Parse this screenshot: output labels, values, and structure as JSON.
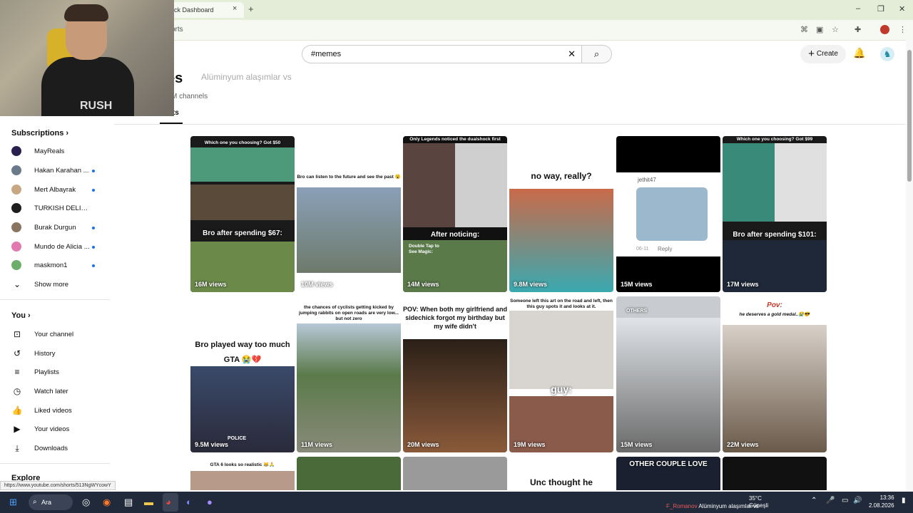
{
  "browser": {
    "tab_title": "ck Dashboard",
    "tab_close": "×",
    "new_tab": "+",
    "address_fragment": "orts",
    "window_controls": {
      "minimize": "–",
      "restore": "❐",
      "close": "✕"
    }
  },
  "webcam": {
    "shirt_text": "RUSH"
  },
  "header": {
    "search_value": "#memes",
    "create_label": "Create"
  },
  "page": {
    "title": "es",
    "title_overlay": "Alüminyum alaşımlar vs",
    "channels": "M channels",
    "active_tab": "rts"
  },
  "sidebar": {
    "subscriptions_heading": "Subscriptions",
    "subscriptions": [
      {
        "label": "MayReals",
        "live": false,
        "color": "#2a2050"
      },
      {
        "label": "Hakan Karahan ...",
        "live": true,
        "color": "#6b7a8a"
      },
      {
        "label": "Mert Albayrak",
        "live": true,
        "color": "#c8a884"
      },
      {
        "label": "TURKISH DELIGHT ...",
        "live": false,
        "color": "#1e1e1e"
      },
      {
        "label": "Burak Durgun",
        "live": true,
        "color": "#8a7460"
      },
      {
        "label": "Mundo de Alicia ...",
        "live": true,
        "color": "#e07ab0"
      },
      {
        "label": "maskmon1",
        "live": true,
        "color": "#6fae6a"
      }
    ],
    "show_more": "Show more",
    "you_heading": "You",
    "you_items": [
      {
        "label": "Your channel",
        "icon": "⊡"
      },
      {
        "label": "History",
        "icon": "↺"
      },
      {
        "label": "Playlists",
        "icon": "≡"
      },
      {
        "label": "Watch later",
        "icon": "◷"
      },
      {
        "label": "Liked videos",
        "icon": "👍"
      },
      {
        "label": "Your videos",
        "icon": "▶"
      },
      {
        "label": "Downloads",
        "icon": "⤓"
      }
    ],
    "explore_heading": "Explore"
  },
  "shorts_row1": [
    {
      "views": "16M views",
      "top_caption": "Which one you choosing? Got $50",
      "caption": "Bro after spending $67:"
    },
    {
      "views": "10M views",
      "top_caption": "Bro can listen to the future and see the past 😮"
    },
    {
      "views": "14M views",
      "top_caption": "Only Legends noticed the dualshock first",
      "caption": "After noticing:",
      "bottom_caption": "Double Tap to See Magic:"
    },
    {
      "views": "9.8M views",
      "caption": "no way, really?"
    },
    {
      "views": "15M views",
      "comment_user": "jethit47",
      "comment_date": "06-11",
      "comment_reply": "Reply"
    },
    {
      "views": "17M views",
      "top_caption": "Which one you choosing? Got $99",
      "caption": "Bro after spending $101:"
    }
  ],
  "shorts_row2": [
    {
      "views": "9.5M views",
      "caption": "Bro played way too much GTA 😭💔",
      "badge": "POLICE"
    },
    {
      "views": "11M views",
      "top_caption": "the chances of cyclists getting kicked by jumping rabbits on open roads are very low... but not zero"
    },
    {
      "views": "20M views",
      "caption": "POV: When both my girlfriend and sidechick forgot my birthday but my wife didn't"
    },
    {
      "views": "19M views",
      "top_caption": "Someone left this art on the road and left, then this guy spots it and looks at it.",
      "caption": "guy:"
    },
    {
      "views": "15M views",
      "caption": "OTHERS"
    },
    {
      "views": "22M views",
      "caption": "Pov:",
      "sub_caption": "he deserves a gold medal..😭😎"
    }
  ],
  "shorts_row3": [
    {
      "caption": "GTA 6 looks so realistic 😹🙏"
    },
    {
      "caption": ""
    },
    {
      "caption": ""
    },
    {
      "caption": "Unc thought he"
    },
    {
      "caption": "OTHER COUPLE LOVE"
    },
    {
      "caption": ""
    }
  ],
  "status_url": "https://www.youtube.com/shorts/513NgWYcowY",
  "taskbar": {
    "search_label": "Ara",
    "temperature": "35°C",
    "weather_sub": "Güneşli",
    "ticker_name": "F_Romanov",
    "ticker_text": "Alüminyum alaşımlar vs",
    "time": "13:36",
    "date": "2.08.2026"
  }
}
